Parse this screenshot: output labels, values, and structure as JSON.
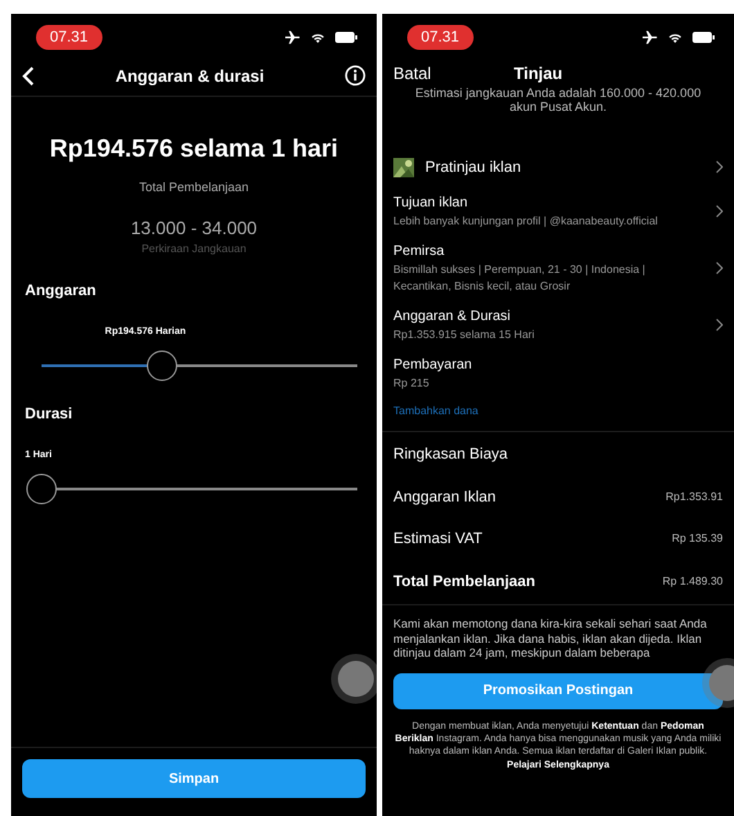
{
  "left_screen": {
    "status_bar": {
      "time": "07.31"
    },
    "header": {
      "title": "Anggaran & durasi"
    },
    "summary": {
      "amount": "Rp194.576 selama 1 hari",
      "amount_label": "Total Pembelanjaan",
      "reach": "13.000 - 34.000",
      "reach_label": "Perkiraan Jangkauan"
    },
    "sliders": [
      {
        "label": "Anggaran",
        "value_label": "Rp194.576 Harian",
        "level": 0.4
      },
      {
        "label": "Durasi",
        "value_label": "1 Hari",
        "level": 0
      }
    ],
    "save_button": "Simpan"
  },
  "right_screen": {
    "status_bar": {
      "time": "07.31"
    },
    "header": {
      "cancel": "Batal",
      "title": "Tinjau"
    },
    "reach_note": "Estimasi jangkauan Anda adalah 160.000 - 420.000 akun Pusat Akun.",
    "preview": {
      "label": "Pratinjau iklan"
    },
    "rows": [
      {
        "title": "Tujuan iklan",
        "detail": "Lebih banyak kunjungan profil | @kaanabeauty.official",
        "chevron": true
      },
      {
        "title": "Pemirsa",
        "detail": "Bismillah sukses | Perempuan,  21 - 30 | Indonesia | Kecantikan, Bisnis kecil, atau Grosir",
        "chevron": true
      },
      {
        "title": "Anggaran & Durasi",
        "detail": "Rp1.353.915 selama 15 Hari",
        "chevron": true
      },
      {
        "title": "Pembayaran",
        "detail": "Rp 215",
        "chevron": false
      }
    ],
    "add_funds_link": "Tambahkan dana",
    "cost_summary": {
      "title": "Ringkasan Biaya",
      "items": [
        {
          "label": "Anggaran Iklan",
          "value": "Rp1.353.91",
          "total": false
        },
        {
          "label": "Estimasi VAT",
          "value": "Rp 135.39",
          "total": false
        },
        {
          "label": "Total Pembelanjaan",
          "value": "Rp 1.489.30",
          "total": true
        }
      ]
    },
    "billing_note": "Kami akan memotong dana kira-kira sekali sehari saat Anda menjalankan iklan. Jika dana habis, iklan akan dijeda. Iklan ditinjau dalam 24 jam, meskipun dalam beberapa",
    "promote_button": "Promosikan Postingan",
    "disclaimer": "Dengan membuat iklan, Anda menyetujui **Ketentuan** dan **Pedoman Beriklan** Instagram. Anda hanya bisa menggunakan musik yang Anda miliki haknya dalam iklan Anda. Semua iklan terdaftar di Galeri Iklan publik. **Pelajari Selengkapnya**"
  }
}
